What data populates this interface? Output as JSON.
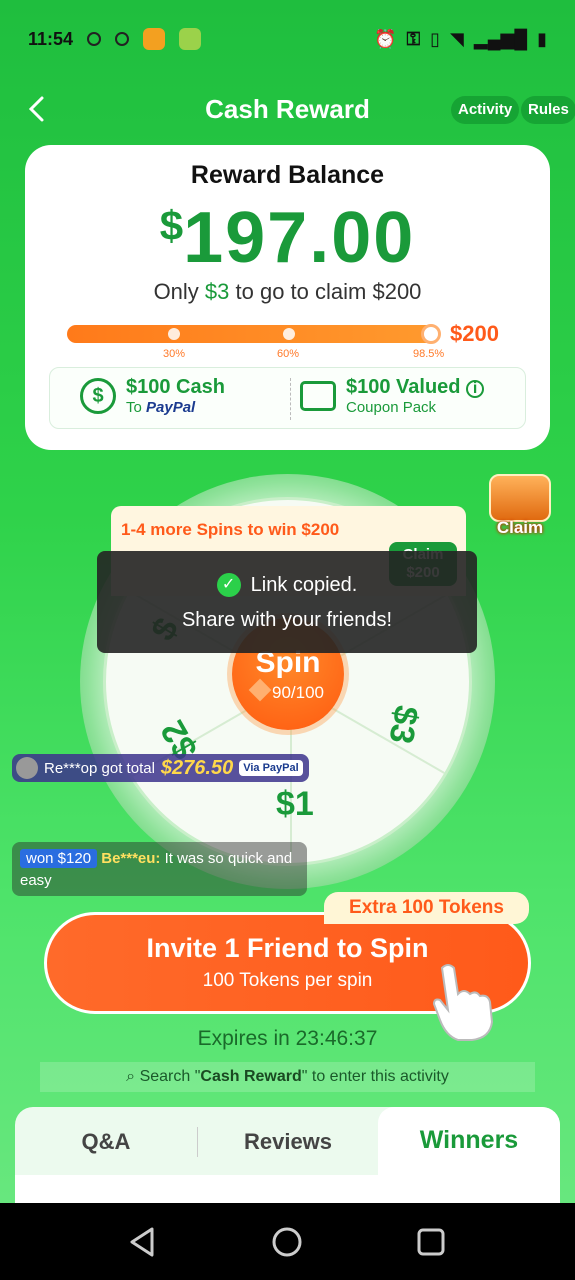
{
  "status_bar": {
    "time": "11:54"
  },
  "header": {
    "title": "Cash Reward",
    "activity_label": "Activity",
    "rules_label": "Rules"
  },
  "balance": {
    "title": "Reward Balance",
    "currency": "$",
    "amount": "197.00",
    "togo_prefix": "Only ",
    "togo_amount": "$3",
    "togo_suffix": " to go to claim $200",
    "progress_target": "$200",
    "progress_fraction": 0.985,
    "ticks": [
      "30%",
      "60%",
      "98.5%"
    ]
  },
  "rewards": {
    "cash_title": "$100 Cash",
    "cash_to": "To ",
    "cash_paypal": "PayPal",
    "coupon_title": "$100 Valued",
    "coupon_sub": "Coupon Pack"
  },
  "wheel": {
    "banner_text": "1-4 more Spins to win $200",
    "banner_claim": "Claim $200",
    "spin_label": "Spin",
    "tokens": "90/100",
    "labels": [
      "$3",
      "$1",
      "$2",
      "$"
    ]
  },
  "toast": {
    "line1": "Link copied.",
    "line2": "Share with your friends!"
  },
  "chest": {
    "label": "Claim"
  },
  "tickers": {
    "t1_user": "Re***op got total",
    "t1_amount": "$276.50",
    "t1_via": "Via PayPal",
    "t2_won": "won $120",
    "t2_user": "Be***eu:",
    "t2_text": " It was so quick and easy"
  },
  "invite": {
    "extra": "Extra 100 Tokens",
    "title": "Invite 1 Friend to Spin",
    "subtitle": "100 Tokens per spin"
  },
  "expires": "Expires in 23:46:37",
  "search_hint": {
    "prefix": "Search \"",
    "term": "Cash Reward",
    "suffix": "\" to enter this activity"
  },
  "tabs": [
    "Q&A",
    "Reviews",
    "Winners"
  ],
  "colors": {
    "brand_green": "#1a9a3a",
    "accent_orange": "#ff5a1a"
  }
}
